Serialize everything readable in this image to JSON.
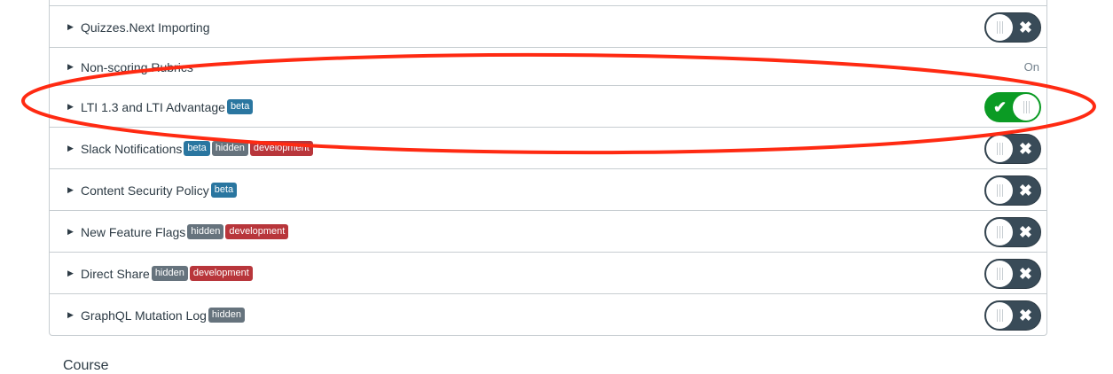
{
  "features": [
    {
      "name": "Quizzes.Next Importing",
      "badges": [],
      "state": "off"
    },
    {
      "name": "Non-scoring Rubrics",
      "badges": [],
      "state": "text",
      "status": "On"
    },
    {
      "name": "LTI 1.3 and LTI Advantage",
      "badges": [
        "beta"
      ],
      "state": "on"
    },
    {
      "name": "Slack Notifications",
      "badges": [
        "beta",
        "hidden",
        "development"
      ],
      "state": "off"
    },
    {
      "name": "Content Security Policy",
      "badges": [
        "beta"
      ],
      "state": "off"
    },
    {
      "name": "New Feature Flags",
      "badges": [
        "hidden",
        "development"
      ],
      "state": "off"
    },
    {
      "name": "Direct Share",
      "badges": [
        "hidden",
        "development"
      ],
      "state": "off"
    },
    {
      "name": "GraphQL Mutation Log",
      "badges": [
        "hidden"
      ],
      "state": "off"
    }
  ],
  "section_heading": "Course",
  "colors": {
    "toggle_on": "#0b9b24",
    "toggle_off": "#394b58",
    "beta": "#2a76a0",
    "hidden": "#66737d",
    "development": "#b8363b",
    "annotation": "#ff2a12"
  },
  "icons": {
    "off": "x-icon",
    "on": "check-icon"
  }
}
